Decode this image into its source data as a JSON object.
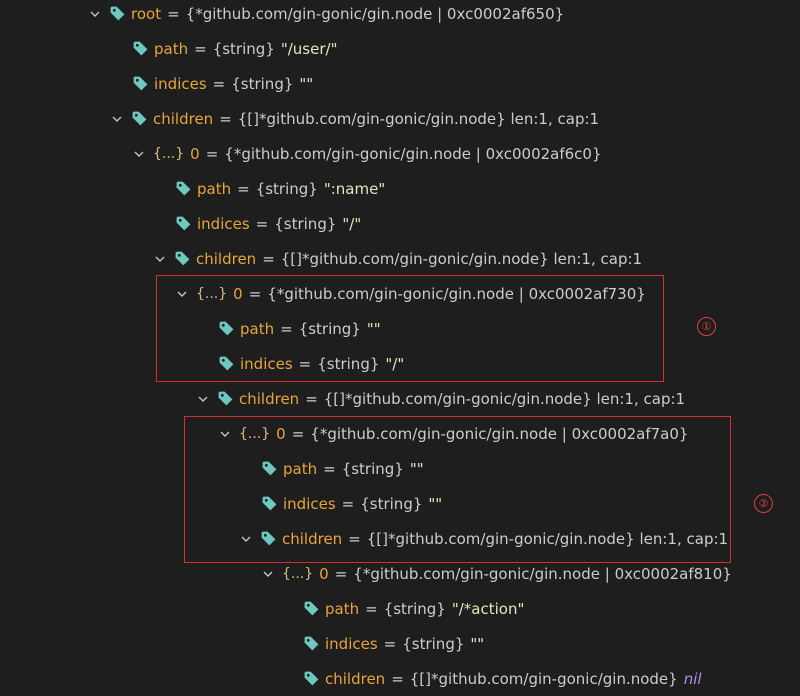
{
  "colors": {
    "key": "#e8a53a",
    "string_value": "#e8e5bb",
    "nil": "#b48ee6",
    "tag_icon": "#6fc8c0",
    "highlight_box": "#d32f2f"
  },
  "rows": [
    {
      "key": "root",
      "type": "{*github.com/gin-gonic/gin.node | 0xc0002af650}",
      "value": ""
    },
    {
      "key": "path",
      "type": "{string}",
      "value": "\"/user/\""
    },
    {
      "key": "indices",
      "type": "{string}",
      "value": "\"\""
    },
    {
      "key": "children",
      "type": "{[]*github.com/gin-gonic/gin.node} len:1, cap:1",
      "value": ""
    },
    {
      "brace": "{...}",
      "key": "0",
      "type": "{*github.com/gin-gonic/gin.node | 0xc0002af6c0}",
      "value": ""
    },
    {
      "key": "path",
      "type": "{string}",
      "value": "\":name\""
    },
    {
      "key": "indices",
      "type": "{string}",
      "value": "\"/\""
    },
    {
      "key": "children",
      "type": "{[]*github.com/gin-gonic/gin.node} len:1, cap:1",
      "value": ""
    },
    {
      "brace": "{...}",
      "key": "0",
      "type": "{*github.com/gin-gonic/gin.node | 0xc0002af730}",
      "value": ""
    },
    {
      "key": "path",
      "type": "{string}",
      "value": "\"\""
    },
    {
      "key": "indices",
      "type": "{string}",
      "value": "\"/\""
    },
    {
      "key": "children",
      "type": "{[]*github.com/gin-gonic/gin.node} len:1, cap:1",
      "value": ""
    },
    {
      "brace": "{...}",
      "key": "0",
      "type": "{*github.com/gin-gonic/gin.node | 0xc0002af7a0}",
      "value": ""
    },
    {
      "key": "path",
      "type": "{string}",
      "value": "\"\""
    },
    {
      "key": "indices",
      "type": "{string}",
      "value": "\"\""
    },
    {
      "key": "children",
      "type": "{[]*github.com/gin-gonic/gin.node} len:1, cap:1",
      "value": ""
    },
    {
      "brace": "{...}",
      "key": "0",
      "type": "{*github.com/gin-gonic/gin.node | 0xc0002af810}",
      "value": ""
    },
    {
      "key": "path",
      "type": "{string}",
      "value": "\"/*action\""
    },
    {
      "key": "indices",
      "type": "{string}",
      "value": "\"\""
    },
    {
      "key": "children",
      "type": "{[]*github.com/gin-gonic/gin.node}",
      "value": "",
      "nil": "nil"
    }
  ],
  "annotations": {
    "marker_1": "①",
    "marker_2": "②"
  }
}
